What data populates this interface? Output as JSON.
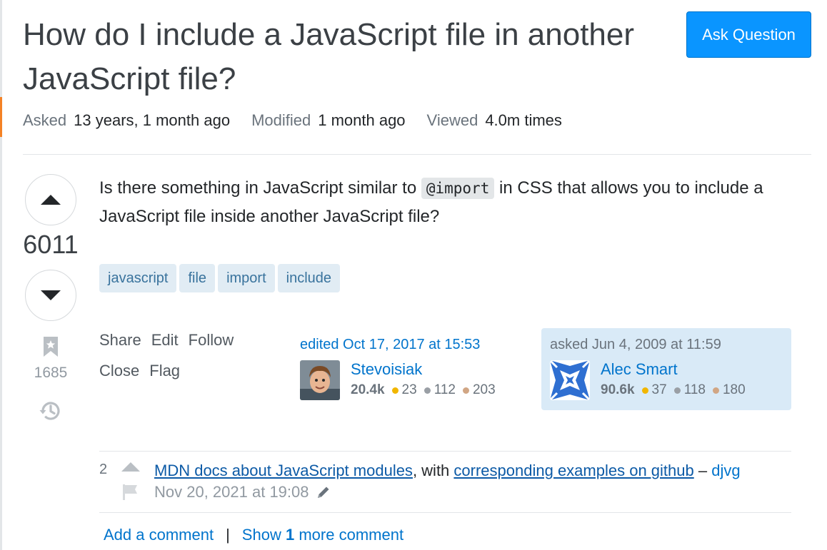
{
  "question": {
    "title": "How do I include a JavaScript file in another JavaScript file?",
    "body_before_code": "Is there something in JavaScript similar to ",
    "body_code": "@import",
    "body_after_code": " in CSS that allows you to include a JavaScript file inside another JavaScript file?",
    "votes": "6011",
    "bookmarks": "1685"
  },
  "header": {
    "ask_button": "Ask Question"
  },
  "meta": {
    "asked_label": "Asked",
    "asked_value": "13 years, 1 month ago",
    "modified_label": "Modified",
    "modified_value": "1 month ago",
    "viewed_label": "Viewed",
    "viewed_value": "4.0m times"
  },
  "tags": [
    "javascript",
    "file",
    "import",
    "include"
  ],
  "post_actions": {
    "share": "Share",
    "edit": "Edit",
    "follow": "Follow",
    "close": "Close",
    "flag": "Flag"
  },
  "editor": {
    "action": "edited Oct 17, 2017 at 15:53",
    "name": "Stevoisiak",
    "reputation": "20.4k",
    "gold": "23",
    "silver": "112",
    "bronze": "203"
  },
  "asker": {
    "action": "asked Jun 4, 2009 at 11:59",
    "name": "Alec Smart",
    "reputation": "90.6k",
    "gold": "37",
    "silver": "118",
    "bronze": "180"
  },
  "comment": {
    "score": "2",
    "link1": "MDN docs about JavaScript modules",
    "middle": ", with ",
    "link2": "corresponding examples on github",
    "dash": " – ",
    "user": "djvg",
    "date": "Nov 20, 2021 at 19:08"
  },
  "comment_actions": {
    "add": "Add a comment",
    "separator": "|",
    "show_prefix": "Show",
    "show_count": "1",
    "show_suffix": "more comment"
  },
  "colors": {
    "accent": "#0a95ff",
    "link": "#0074cc",
    "tag_bg": "#e1ecf4",
    "tag_text": "#39739d",
    "owner_card_bg": "#d9eaf7",
    "gold": "#f1b600",
    "silver": "#9a9fa5",
    "bronze": "#d1a684"
  },
  "icons": [
    "upvote-icon",
    "downvote-icon",
    "bookmark-icon",
    "history-icon",
    "flag-icon",
    "pencil-icon"
  ]
}
